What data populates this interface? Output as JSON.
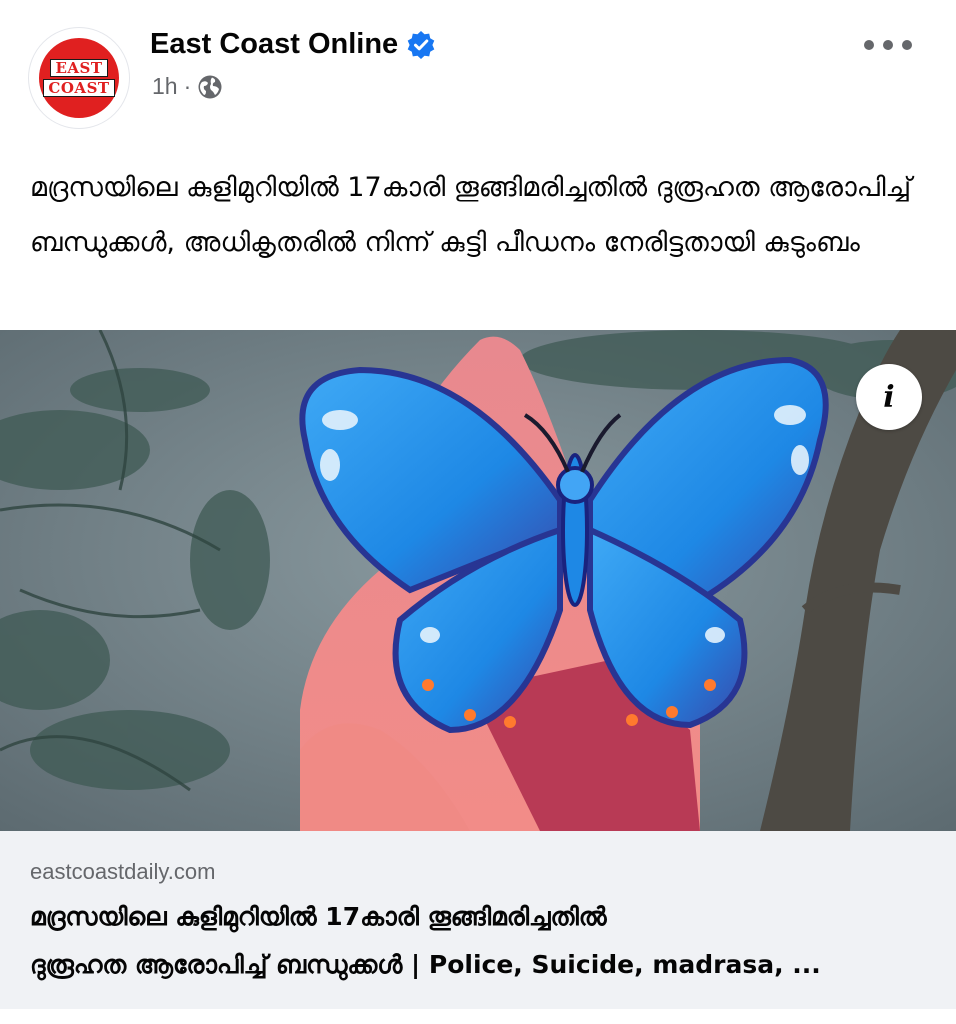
{
  "post": {
    "author": "East Coast Online",
    "avatar_logo_lines": [
      "EAST",
      "COAST"
    ],
    "time": "1h",
    "separator": "·",
    "caption": "മദ്രസയിലെ കുളിമുറിയിൽ 17കാരി തൂങ്ങിമരിച്ചതിൽ ദുരൂഹത ആരോപിച്ച് ബന്ധുക്കൾ, അധികൃതരിൽ നിന്ന് കുട്ടി പീഡനം നേരിട്ടതായി കുടുംബം",
    "info_label": "i"
  },
  "link_preview": {
    "domain": "eastcoastdaily.com",
    "title_line1": "മദ്രസയിലെ കുളിമുറിയിൽ 17കാരി തൂങ്ങിമരിച്ചതിൽ",
    "title_line2": "ദുരൂഹത ആരോപിച്ച് ബന്ധുക്കൾ | Police, Suicide, madrasa, ..."
  },
  "icons": {
    "verified": "verified-badge-icon",
    "audience": "globe-icon",
    "more": "more-options-icon",
    "info": "info-icon",
    "overlay": "butterfly-emoji"
  },
  "colors": {
    "verified_blue": "#1877f2",
    "secondary_text": "#65676b",
    "link_bg": "#f0f2f5",
    "brand_red": "#e02020"
  }
}
